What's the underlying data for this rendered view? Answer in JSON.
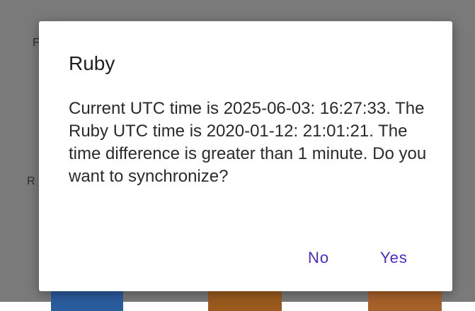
{
  "dialog": {
    "title": "Ruby",
    "message": "Current UTC time is 2025-06-03: 16:27:33. The Ruby UTC time is 2020-01-12: 21:01:21. The time difference is greater than 1 minute. Do you want to synchronize?",
    "buttons": {
      "no_label": "No",
      "yes_label": "Yes"
    }
  },
  "background": {
    "visible_letters": [
      "F",
      "R"
    ]
  },
  "colors": {
    "scrim": "#7a7a7a",
    "dialog_bg": "#ffffff",
    "button_text": "#4a2bd0"
  }
}
